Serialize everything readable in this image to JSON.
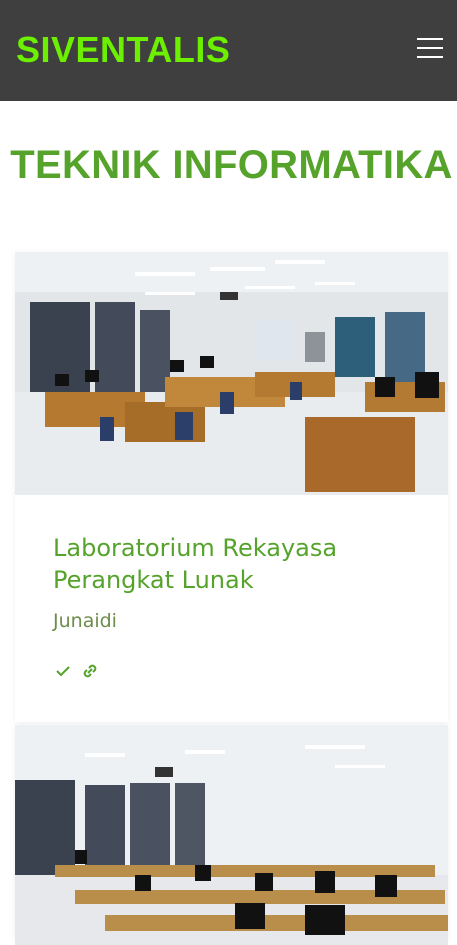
{
  "navbar": {
    "brand": "SIVENTALIS",
    "menu_icon": "hamburger-menu-icon"
  },
  "page": {
    "title": "TEKNIK INFORMATIKA"
  },
  "cards": [
    {
      "title": "Laboratorium Rekayasa Perangkat Lunak",
      "subtitle": "Junaidi",
      "icons": [
        "check-icon",
        "link-icon"
      ]
    },
    {
      "title": "",
      "subtitle": ""
    }
  ],
  "colors": {
    "navbar_bg": "#3f3f3f",
    "brand": "#6cf000",
    "accent_green": "#56a32c"
  }
}
